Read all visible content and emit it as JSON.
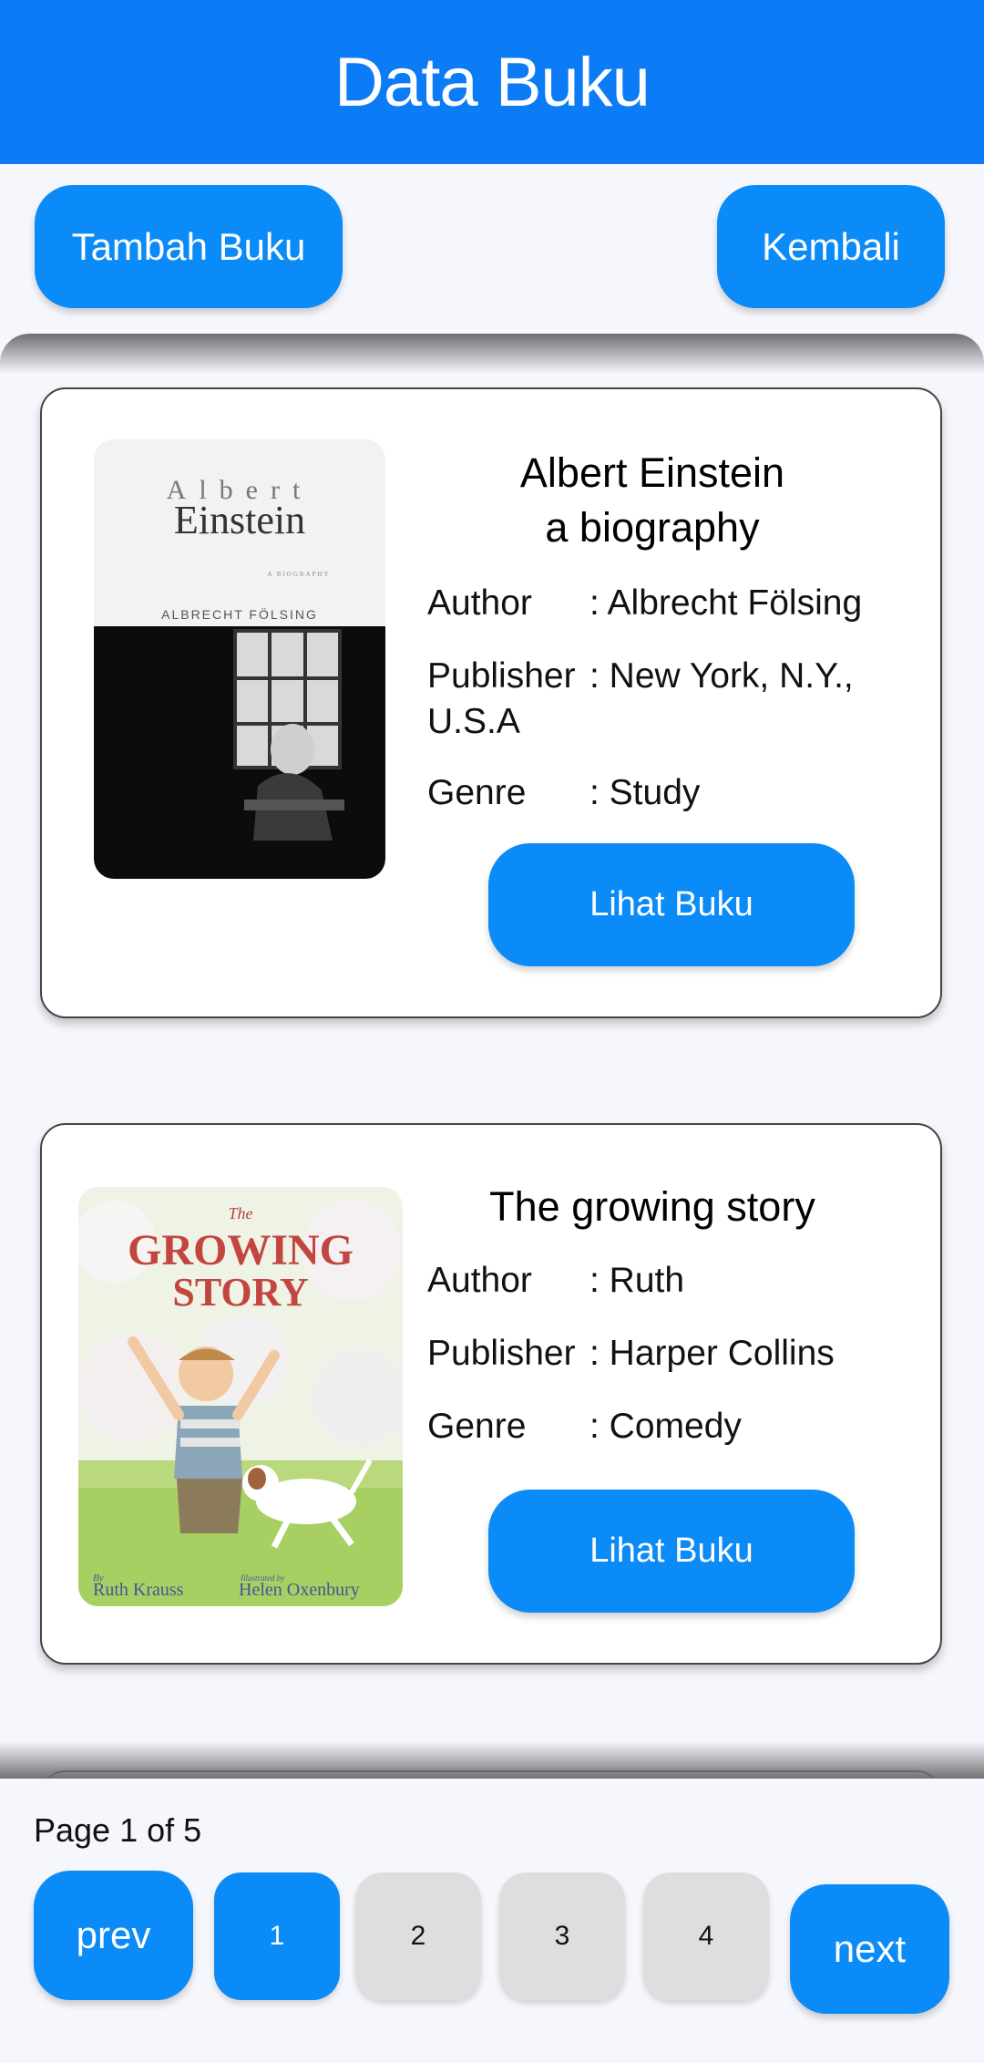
{
  "header": {
    "title": "Data Buku"
  },
  "actions": {
    "add_label": "Tambah Buku",
    "back_label": "Kembali"
  },
  "books": [
    {
      "title_line1": "Albert Einstein",
      "title_line2": "a biography",
      "author_label": "Author",
      "author": ": Albrecht Fölsing",
      "publisher_label": "Publisher",
      "publisher": ": New York, N.Y., U.S.A",
      "genre_label": "Genre",
      "genre": ": Study",
      "view_label": "Lihat Buku",
      "cover": {
        "top_text": "Albert",
        "main_text": "Einstein",
        "sub_text": "A BIOGRAPHY",
        "author_text": "ALBRECHT FÖLSING"
      }
    },
    {
      "title_line1": "The growing story",
      "author_label": "Author",
      "author": ": Ruth",
      "publisher_label": "Publisher",
      "publisher": ": Harper Collins",
      "genre_label": "Genre",
      "genre": ": Comedy",
      "view_label": "Lihat Buku",
      "cover": {
        "the_text": "The",
        "title_line1": "GROWING",
        "title_line2": "STORY",
        "author_text": "Ruth Krauss",
        "illustrator_text": "Helen Oxenbury",
        "by_text": "By",
        "illustrated_by_text": "Illustrated by"
      }
    }
  ],
  "pagination": {
    "info": "Page 1 of 5",
    "prev_label": "prev",
    "next_label": "next",
    "pages": [
      "1",
      "2",
      "3",
      "4"
    ],
    "current": "1"
  },
  "colors": {
    "header": "#0b7bf6",
    "button": "#0a8bf7",
    "page_inactive": "#dedede",
    "background": "#f6f7fd"
  }
}
